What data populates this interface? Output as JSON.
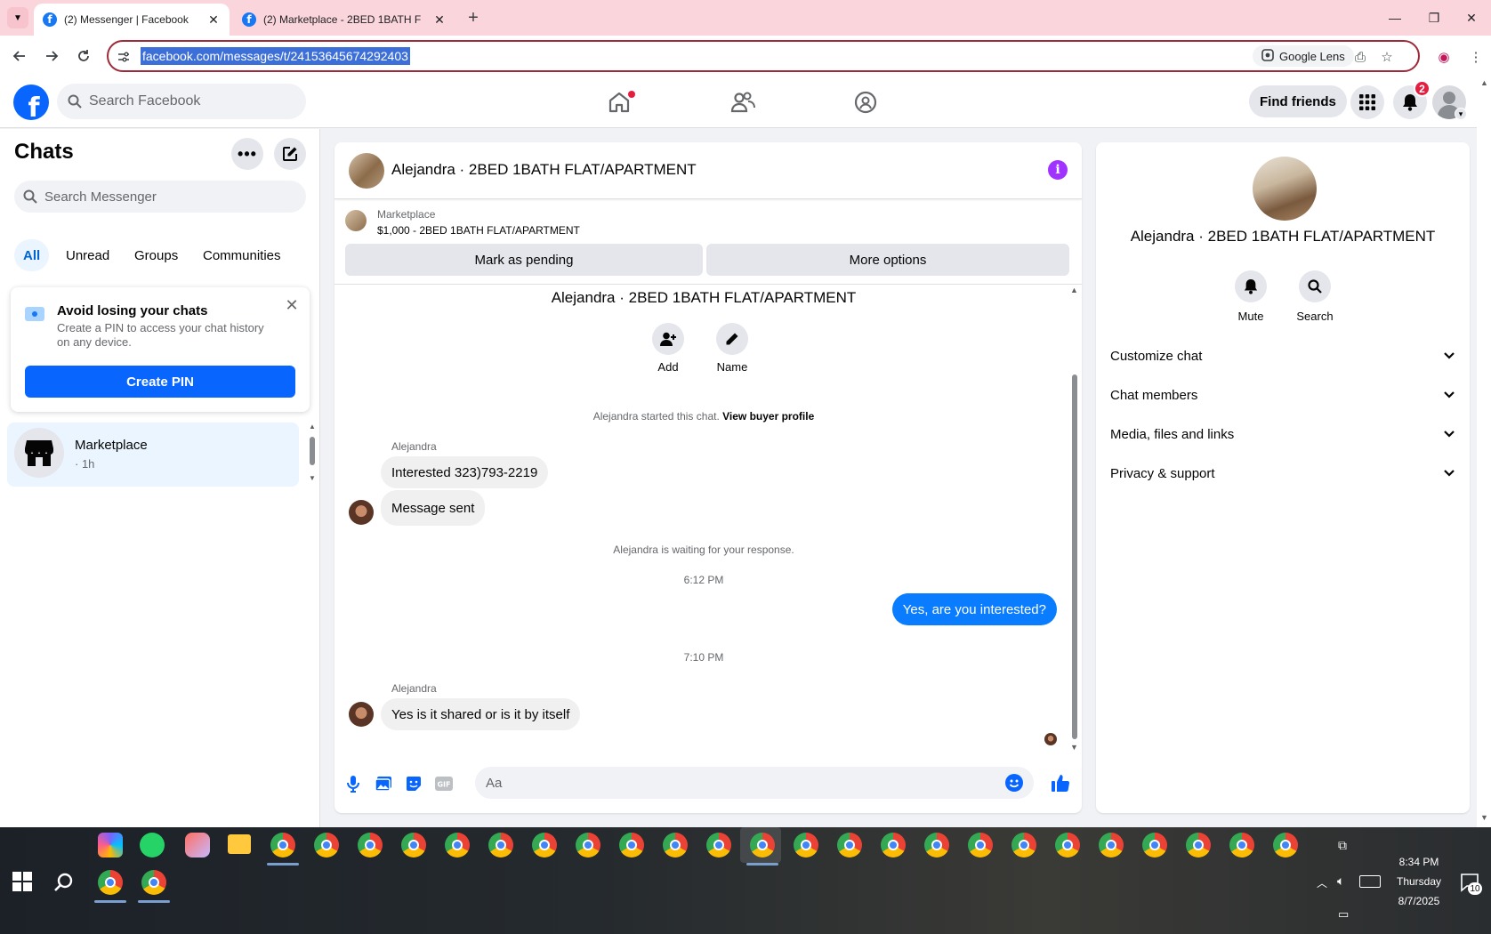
{
  "browser": {
    "tabs": [
      {
        "title": "(2) Messenger | Facebook",
        "favicon": "facebook-icon",
        "active": true
      },
      {
        "title": "(2) Marketplace - 2BED 1BATH F",
        "favicon": "facebook-icon",
        "active": false
      }
    ],
    "new_tab_symbol": "+",
    "url": "facebook.com/messages/t/24153645674292403",
    "lens_label": "Google Lens"
  },
  "fb_header": {
    "search_placeholder": "Search Facebook",
    "find_friends_label": "Find friends",
    "notification_count": "2",
    "brand_color": "#0866ff"
  },
  "left": {
    "title": "Chats",
    "search_placeholder": "Search Messenger",
    "filters": [
      "All",
      "Unread",
      "Groups",
      "Communities"
    ],
    "active_filter": "All",
    "pin_card": {
      "title": "Avoid losing your chats",
      "body": "Create a PIN to access your chat history on any device.",
      "button": "Create PIN"
    },
    "chats": [
      {
        "name": "Marketplace",
        "time": "· 1h",
        "icon": "storefront-icon"
      }
    ]
  },
  "conversation": {
    "title": "Alejandra · 2BED 1BATH FLAT/APARTMENT",
    "marketplace_label": "Marketplace",
    "listing": "$1,000 - 2BED 1BATH FLAT/APARTMENT",
    "buttons": {
      "pending": "Mark as pending",
      "more": "More options"
    },
    "intro_name": "Alejandra · 2BED 1BATH FLAT/APARTMENT",
    "actions": {
      "add": "Add",
      "name": "Name"
    },
    "started_text": "Alejandra started this chat.",
    "view_buyer_profile": "View buyer profile",
    "sender_name": "Alejandra",
    "messages_in_1": [
      "Interested 323)793-2219",
      "Message sent"
    ],
    "waiting_text": "Alejandra is waiting for your response.",
    "time_1": "6:12 PM",
    "message_out": "Yes, are you interested?",
    "time_2": "7:10 PM",
    "message_in_2": "Yes is it shared or is it by itself",
    "composer_placeholder": "Aa",
    "outgoing_bubble_color": "#0a7cff"
  },
  "info_panel": {
    "name": "Alejandra · 2BED 1BATH FLAT/APARTMENT",
    "actions": {
      "mute": "Mute",
      "search": "Search"
    },
    "sections": [
      "Customize chat",
      "Chat members",
      "Media, files and links",
      "Privacy & support"
    ]
  },
  "taskbar": {
    "time": "8:34 PM",
    "day": "Thursday",
    "date": "8/7/2025",
    "notifications": "10"
  }
}
